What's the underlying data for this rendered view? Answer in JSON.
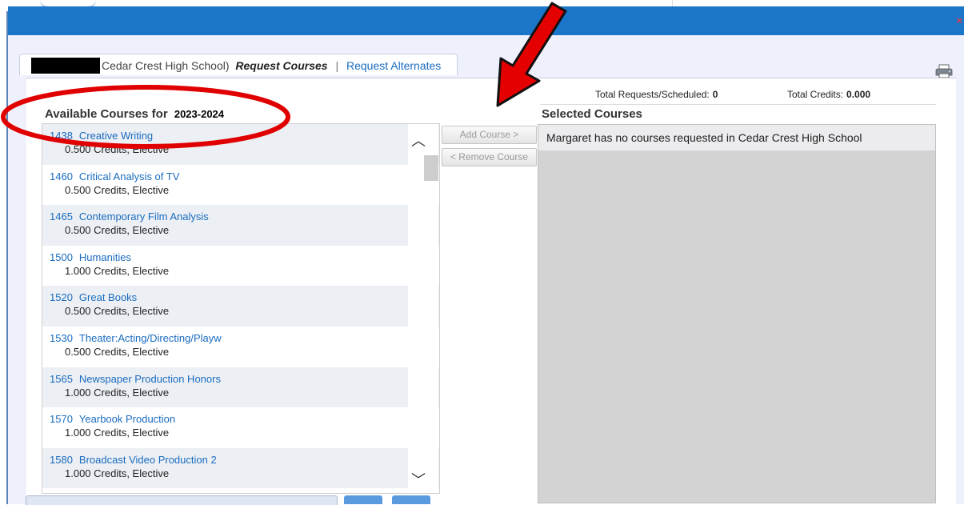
{
  "tab": {
    "school": "Cedar Crest High School)",
    "current": "Request Courses",
    "separator": "|",
    "alternates": "Request Alternates"
  },
  "stats": {
    "requests_label": "Total Requests/Scheduled:",
    "requests_value": "0",
    "credits_label": "Total Credits:",
    "credits_value": "0.000"
  },
  "available": {
    "heading": "Available Courses for",
    "year": "2023-2024"
  },
  "courses": [
    {
      "num": "1438",
      "name": "Creative Writing",
      "detail": "0.500 Credits,  Elective"
    },
    {
      "num": "1460",
      "name": "Critical Analysis of TV",
      "detail": "0.500 Credits,  Elective"
    },
    {
      "num": "1465",
      "name": "Contemporary Film Analysis",
      "detail": "0.500 Credits,  Elective"
    },
    {
      "num": "1500",
      "name": "Humanities",
      "detail": "1.000 Credits,  Elective"
    },
    {
      "num": "1520",
      "name": "Great Books",
      "detail": "0.500 Credits,  Elective"
    },
    {
      "num": "1530",
      "name": "Theater:Acting/Directing/Playw",
      "detail": "0.500 Credits,  Elective"
    },
    {
      "num": "1565",
      "name": "Newspaper Production Honors",
      "detail": "1.000 Credits,  Elective"
    },
    {
      "num": "1570",
      "name": "Yearbook Production",
      "detail": "1.000 Credits,  Elective"
    },
    {
      "num": "1580",
      "name": "Broadcast Video Production 2",
      "detail": "1.000 Credits,  Elective"
    }
  ],
  "buttons": {
    "add": "Add Course >",
    "remove": "< Remove Course"
  },
  "selected": {
    "heading": "Selected Courses",
    "empty_message": "Margaret has no courses requested in Cedar Crest High School"
  },
  "icons": {
    "print": "printer-icon",
    "close": "close-icon",
    "scroll_up": "chevron-up-icon",
    "scroll_down": "chevron-down-icon"
  },
  "colors": {
    "titlebar": "#1b76c9",
    "link": "#1a6cc0",
    "annotation": "#e00000"
  }
}
